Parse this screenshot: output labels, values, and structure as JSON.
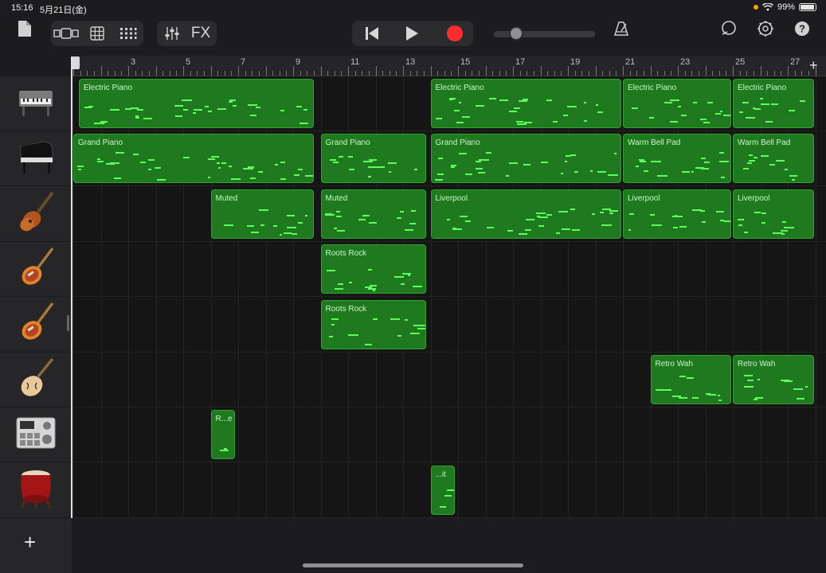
{
  "status": {
    "time": "15:16",
    "date": "5月21日(金)",
    "battery": "99%"
  },
  "toolbar": {
    "fx_label": "FX",
    "icons": [
      "document-icon",
      "track-view-icon",
      "grid-icon",
      "keyboard-icon",
      "mixer-icon",
      "rewind-icon",
      "play-icon",
      "record-icon",
      "metronome-icon",
      "loop-icon",
      "settings-icon",
      "help-icon"
    ]
  },
  "ruler": {
    "labels": [
      "1",
      "3",
      "5",
      "7",
      "9",
      "11",
      "13",
      "15",
      "17",
      "19",
      "21",
      "23",
      "25",
      "27"
    ]
  },
  "tracks": [
    {
      "instrument": "electric-piano",
      "regions": [
        {
          "name": "Electric Piano",
          "start": 1.2,
          "end": 9.8
        },
        {
          "name": "Electric Piano",
          "start": 14.0,
          "end": 21.0
        },
        {
          "name": "Electric Piano",
          "start": 21.0,
          "end": 25.0
        },
        {
          "name": "Electric Piano",
          "start": 25.0,
          "end": 28.0
        }
      ]
    },
    {
      "instrument": "grand-piano",
      "regions": [
        {
          "name": "Grand Piano",
          "start": 1.0,
          "end": 9.8
        },
        {
          "name": "Grand Piano",
          "start": 10.0,
          "end": 13.9
        },
        {
          "name": "Grand Piano",
          "start": 14.0,
          "end": 21.0
        },
        {
          "name": "Warm Bell Pad",
          "start": 21.0,
          "end": 25.0
        },
        {
          "name": "Warm Bell Pad",
          "start": 25.0,
          "end": 28.0
        }
      ]
    },
    {
      "instrument": "bass-guitar",
      "regions": [
        {
          "name": "Muted",
          "start": 6.0,
          "end": 9.8
        },
        {
          "name": "Muted",
          "start": 10.0,
          "end": 13.9
        },
        {
          "name": "Liverpool",
          "start": 14.0,
          "end": 21.0
        },
        {
          "name": "Liverpool",
          "start": 21.0,
          "end": 25.0
        },
        {
          "name": "Liverpool",
          "start": 25.0,
          "end": 28.0
        }
      ]
    },
    {
      "instrument": "electric-guitar",
      "regions": [
        {
          "name": "Roots Rock",
          "start": 10.0,
          "end": 13.9
        }
      ]
    },
    {
      "instrument": "electric-guitar",
      "regions": [
        {
          "name": "Roots Rock",
          "start": 10.0,
          "end": 13.9
        }
      ]
    },
    {
      "instrument": "hollow-body-guitar",
      "regions": [
        {
          "name": "Retro Wah",
          "start": 22.0,
          "end": 25.0
        },
        {
          "name": "Retro Wah",
          "start": 25.0,
          "end": 28.0
        }
      ]
    },
    {
      "instrument": "drum-machine",
      "regions": [
        {
          "name": "R...e",
          "start": 6.0,
          "end": 6.95
        }
      ]
    },
    {
      "instrument": "taiko-drum",
      "regions": [
        {
          "name": "...it",
          "start": 14.0,
          "end": 14.95
        }
      ]
    }
  ],
  "colors": {
    "region_fill": "#1f7a1f",
    "region_border": "#2fa52f",
    "note": "#5cff5c",
    "record": "#ff2d2d"
  }
}
